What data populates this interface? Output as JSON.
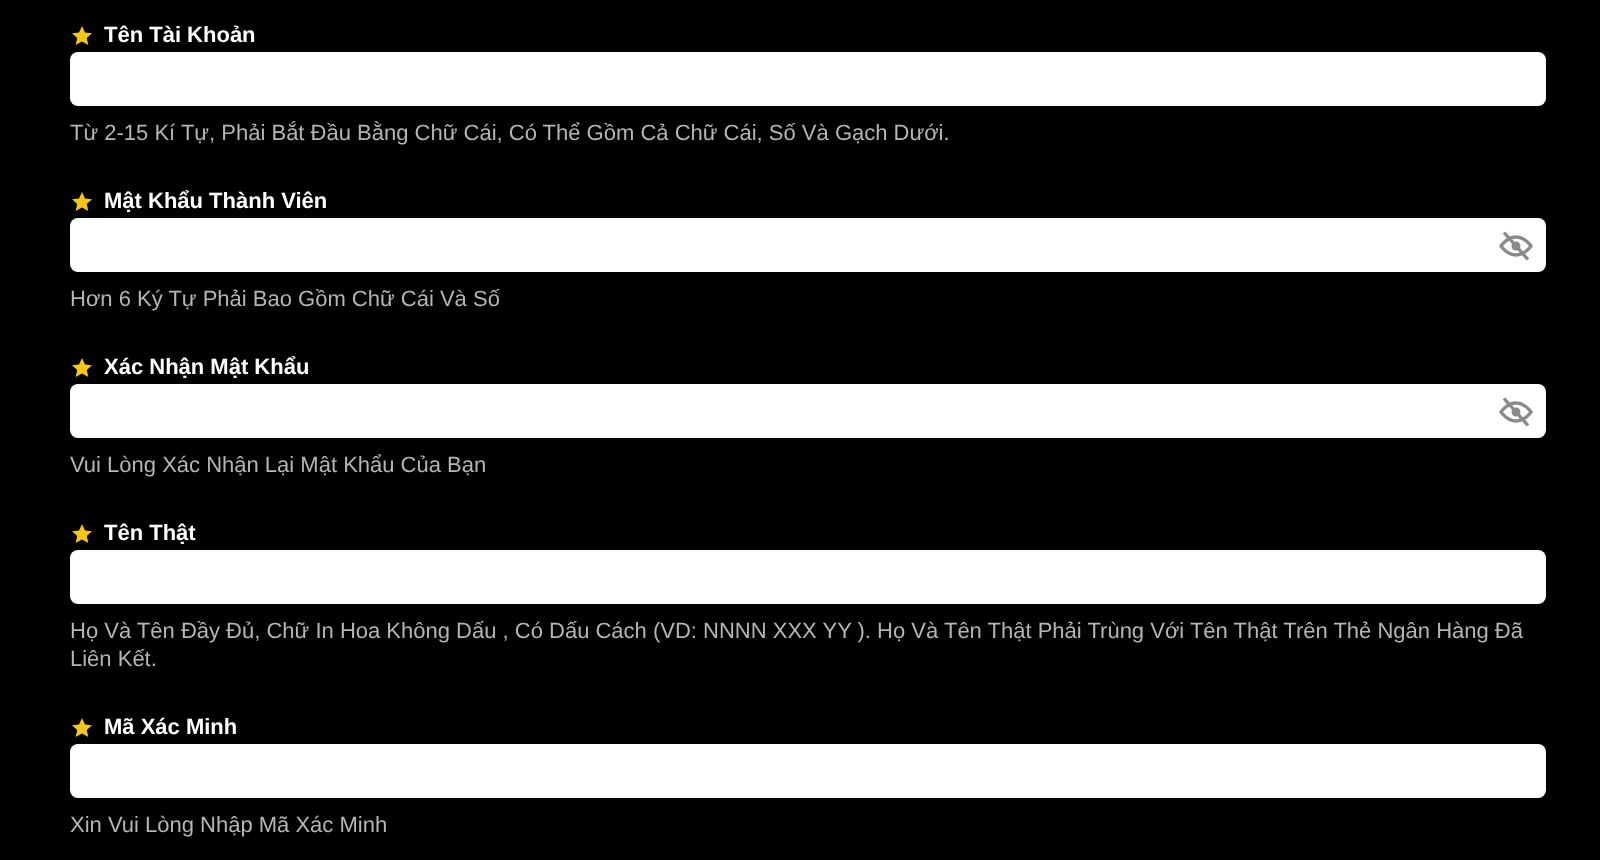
{
  "fields": [
    {
      "label": "Tên Tài Khoản",
      "kind": "text",
      "hint": "Từ 2-15 Kí Tự, Phải Bắt Đầu Bằng Chữ Cái, Có Thể Gồm Cả Chữ Cái, Số Và Gạch Dưới."
    },
    {
      "label": "Mật Khẩu Thành Viên",
      "kind": "password",
      "hint": "Hơn 6 Ký Tự Phải Bao Gồm Chữ Cái Và Số"
    },
    {
      "label": "Xác Nhận Mật Khẩu",
      "kind": "password",
      "hint": "Vui Lòng Xác Nhận Lại Mật Khẩu Của Bạn"
    },
    {
      "label": "Tên Thật",
      "kind": "text",
      "hint": "Họ Và Tên Đầy Đủ, Chữ In Hoa Không Dấu , Có Dấu Cách (VD: NNNN XXX YY ). Họ Và Tên Thật Phải Trùng Với Tên Thật Trên Thẻ Ngân Hàng Đã Liên Kết."
    },
    {
      "label": "Mã Xác Minh",
      "kind": "text",
      "hint": "Xin Vui Lòng Nhập Mã Xác Minh"
    }
  ]
}
